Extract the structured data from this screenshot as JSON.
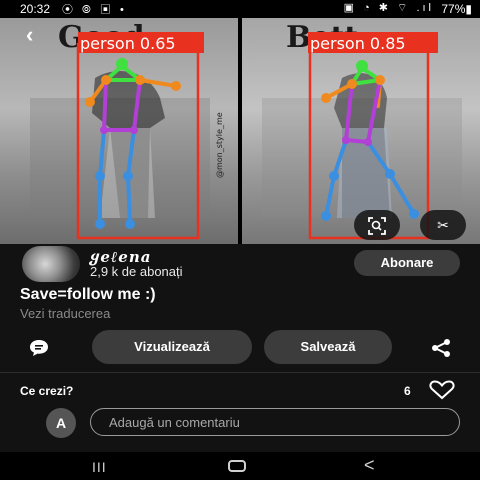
{
  "status_bar": {
    "time": "20:32",
    "left_icons": "⦿ ⦾ ▣ •",
    "right_icons": "▣ ◔ ✱ ⌔ .ıl",
    "battery": "77%▮"
  },
  "image": {
    "back_icon": "‹",
    "left_wall_text": "Good",
    "right_wall_text": "Bett",
    "left_detection_label": "person 0.65",
    "right_detection_label": "person 0.85",
    "watermark": "@mon_style_me",
    "lens_icon": "lens-search-icon",
    "scissors_icon": "✂",
    "box_color": "#e8311f",
    "label_color": "#e8311f"
  },
  "author": {
    "name": "ყeℓena",
    "followers": "2,9 k de abonați",
    "subscribe_label": "Abonare"
  },
  "pin": {
    "title": "Save=follow me :)",
    "translate_label": "Vezi traducerea"
  },
  "actions": {
    "view_label": "Vizualizează",
    "save_label": "Salvează"
  },
  "comments": {
    "label": "Ce crezi?",
    "likes": "6",
    "avatar_initial": "A",
    "placeholder": "Adaugă un comentariu"
  },
  "nav": {
    "recents_icon": "III",
    "back_icon": "<"
  }
}
